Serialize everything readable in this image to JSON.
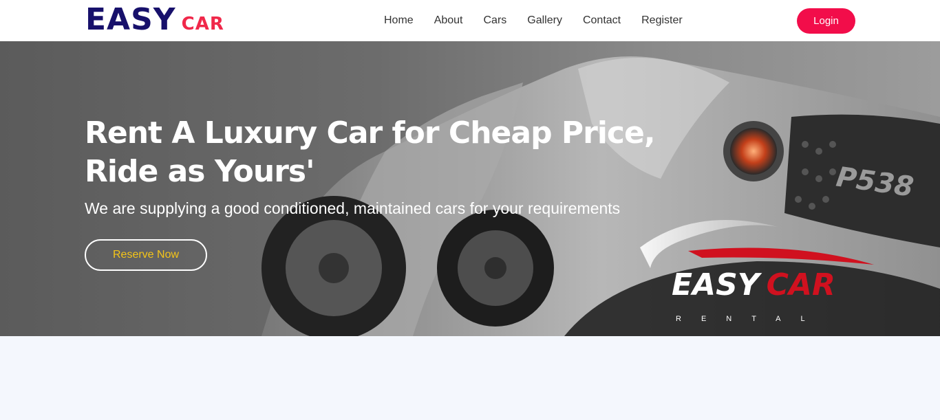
{
  "brand": {
    "main": "EASY",
    "sub": "CAR"
  },
  "nav": {
    "links": [
      "Home",
      "About",
      "Cars",
      "Gallery",
      "Contact",
      "Register"
    ],
    "login_label": "Login"
  },
  "hero": {
    "title_line1": "Rent A Luxury Car for Cheap Price,",
    "title_line2": "Ride as Yours'",
    "subtitle": "We are supplying a good conditioned, maintained cars for your requirements",
    "cta_label": "Reserve Now",
    "car_badge": "P538",
    "logo": {
      "word1": "EASY",
      "word2": "CAR",
      "tagline": "RENTAL"
    }
  },
  "colors": {
    "brand_navy": "#17106b",
    "brand_red": "#f0284a",
    "login_red": "#f20d4a",
    "cta_text": "#f5c518",
    "page_bg": "#f4f7fd"
  }
}
